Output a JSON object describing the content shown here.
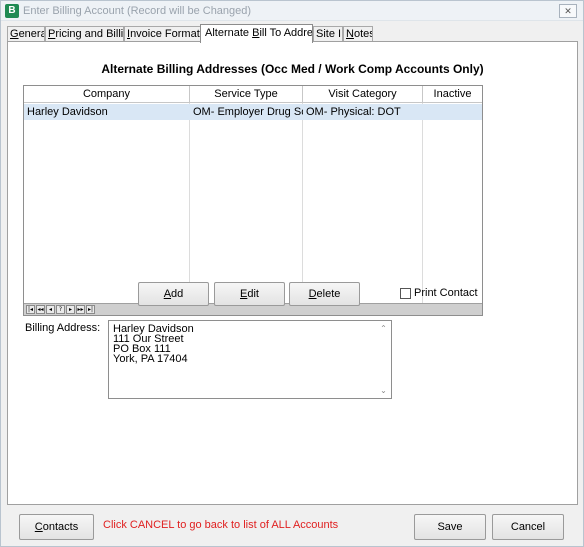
{
  "window": {
    "icon_glyph": "B",
    "title": "Enter Billing Account  (Record will be Changed)",
    "close_glyph": "✕"
  },
  "tabs": [
    {
      "pre": "",
      "acc": "G",
      "post": "eneral"
    },
    {
      "pre": "",
      "acc": "P",
      "post": "ricing and Billing"
    },
    {
      "pre": "",
      "acc": "I",
      "post": "nvoice Formattin"
    },
    {
      "pre": "Alternate ",
      "acc": "B",
      "post": "ill To Addresses"
    },
    {
      "pre": "Site ID",
      "acc": "",
      "post": ""
    },
    {
      "pre": "",
      "acc": "N",
      "post": "otes"
    }
  ],
  "section": {
    "title": "Alternate Billing Addresses (Occ Med / Work Comp Accounts Only)"
  },
  "grid": {
    "columns": [
      "Company",
      "Service Type",
      "Visit Category",
      "Inactive"
    ],
    "rows": [
      [
        "Harley Davidson",
        "OM- Employer Drug Sc",
        "OM- Physical: DOT",
        ""
      ]
    ],
    "navigator": [
      "|◂",
      "◂◂",
      "◂",
      "?",
      "▸",
      "▸▸",
      "▸|"
    ]
  },
  "buttons": {
    "add": {
      "acc": "A",
      "post": "dd"
    },
    "edit": {
      "acc": "E",
      "post": "dit"
    },
    "delete": {
      "acc": "D",
      "post": "elete"
    }
  },
  "print_contact": {
    "label": "Print Contact",
    "checked": false
  },
  "billing_address": {
    "label": "Billing Address:",
    "lines": [
      "Harley Davidson",
      "111 Our Street",
      "PO Box 111",
      "York, PA 17404"
    ],
    "scroll_up_glyph": "⌃",
    "scroll_down_glyph": "⌄"
  },
  "footer": {
    "contacts": {
      "acc": "C",
      "post": "ontacts"
    },
    "message": "Click CANCEL to go back to list of ALL Accounts",
    "save": "Save",
    "cancel": "Cancel"
  },
  "colors": {
    "accent_green": "#1f8a53",
    "message_red": "#e02020",
    "selected_row": "#d9e7f5"
  }
}
